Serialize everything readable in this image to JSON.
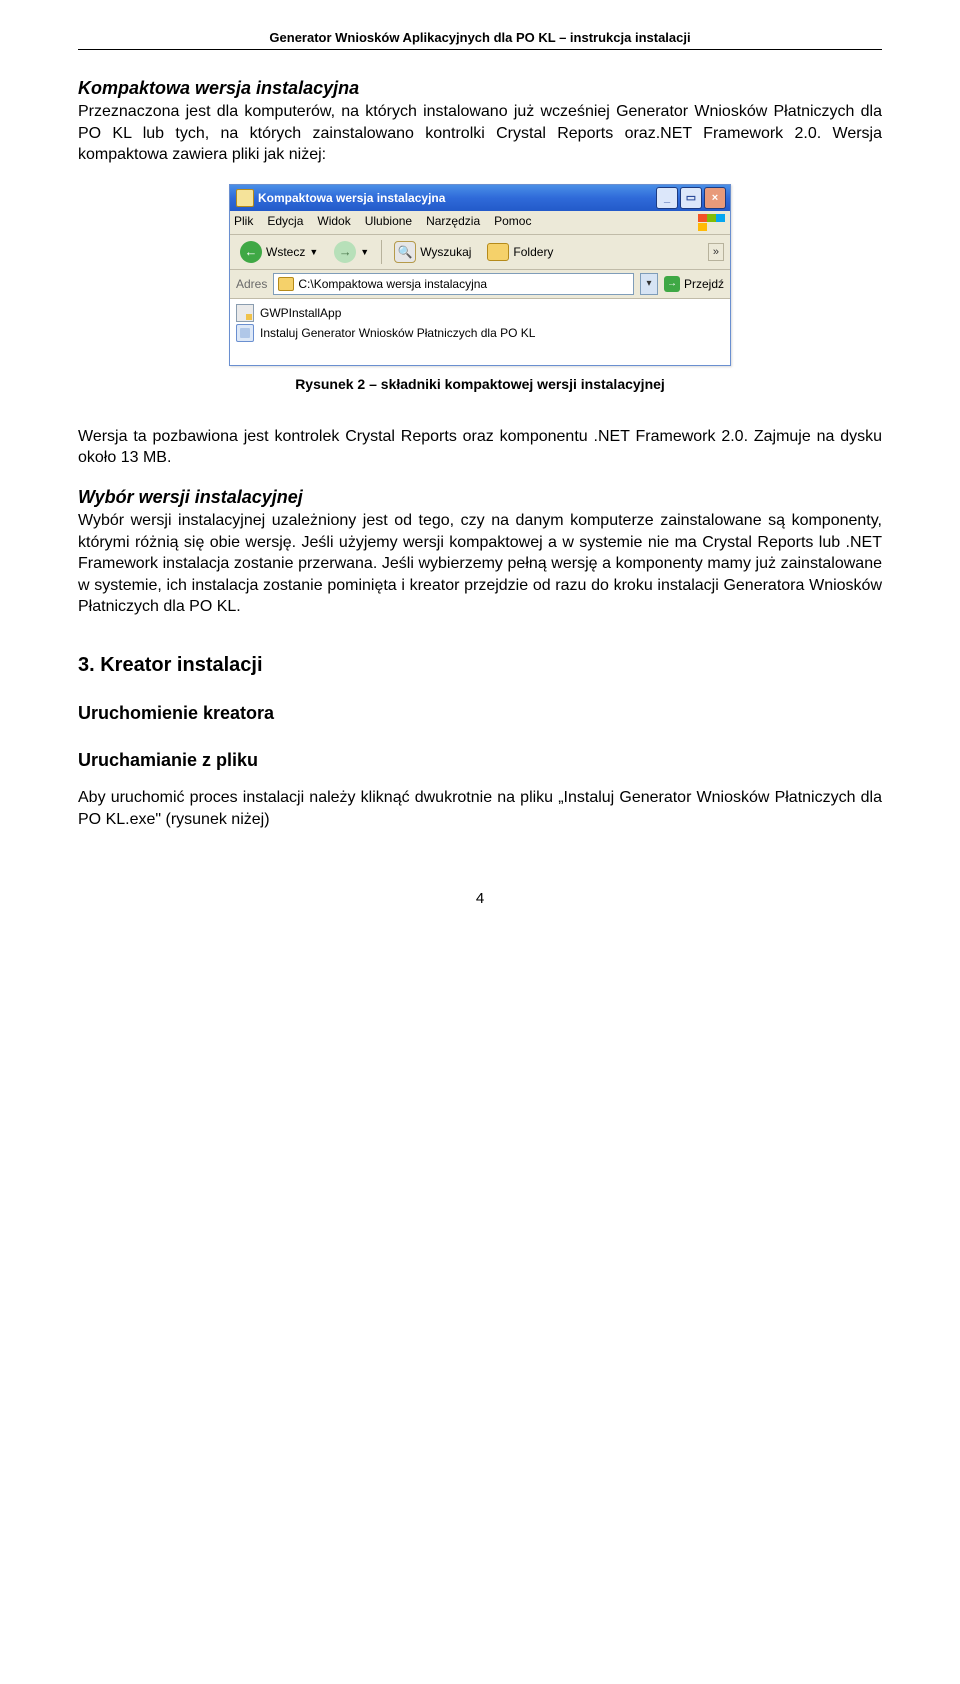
{
  "running_head": "Generator Wniosków Aplikacyjnych dla PO KL – instrukcja instalacji",
  "section_kompakt_title": "Kompaktowa wersja instalacyjna",
  "section_kompakt_body": "Przeznaczona jest dla komputerów, na których instalowano już wcześniej Generator Wniosków Płatniczych dla PO KL lub tych, na których zainstalowano kontrolki Crystal Reports oraz.NET Framework 2.0. Wersja kompaktowa zawiera pliki jak niżej:",
  "xp": {
    "title": "Kompaktowa wersja instalacyjna",
    "menu": [
      "Plik",
      "Edycja",
      "Widok",
      "Ulubione",
      "Narzędzia",
      "Pomoc"
    ],
    "back": "Wstecz",
    "search": "Wyszukaj",
    "folders": "Foldery",
    "addr_label": "Adres",
    "addr_path": "C:\\Kompaktowa wersja instalacyjna",
    "go": "Przejdź",
    "files": [
      "GWPInstallApp",
      "Instaluj Generator Wniosków Płatniczych dla PO KL"
    ]
  },
  "caption_fig2": "Rysunek 2 – składniki kompaktowej wersji instalacyjnej",
  "para_after_fig2": "Wersja ta pozbawiona jest kontrolek Crystal Reports oraz komponentu .NET Framework 2.0. Zajmuje na dysku około 13 MB.",
  "section_wybor_title": "Wybór wersji instalacyjnej",
  "section_wybor_body": "Wybór wersji instalacyjnej uzależniony jest od tego, czy na danym komputerze zainstalowane są komponenty, którymi różnią się obie wersję. Jeśli użyjemy wersji kompaktowej a w systemie nie ma Crystal Reports lub .NET Framework instalacja zostanie przerwana. Jeśli wybierzemy pełną wersję a komponenty mamy już zainstalowane w systemie, ich instalacja zostanie pominięta i kreator przejdzie od razu do kroku instalacji Generatora Wniosków Płatniczych dla PO KL.",
  "h2_kreator": "3. Kreator instalacji",
  "h3_uruchomienie": "Uruchomienie kreatora",
  "h3_uruchamianie_z_pliku": "Uruchamianie z pliku",
  "para_uruchamianie": "Aby uruchomić proces instalacji należy kliknąć dwukrotnie na pliku „Instaluj Generator Wniosków Płatniczych dla PO KL.exe\" (rysunek niżej)",
  "page_number": "4"
}
